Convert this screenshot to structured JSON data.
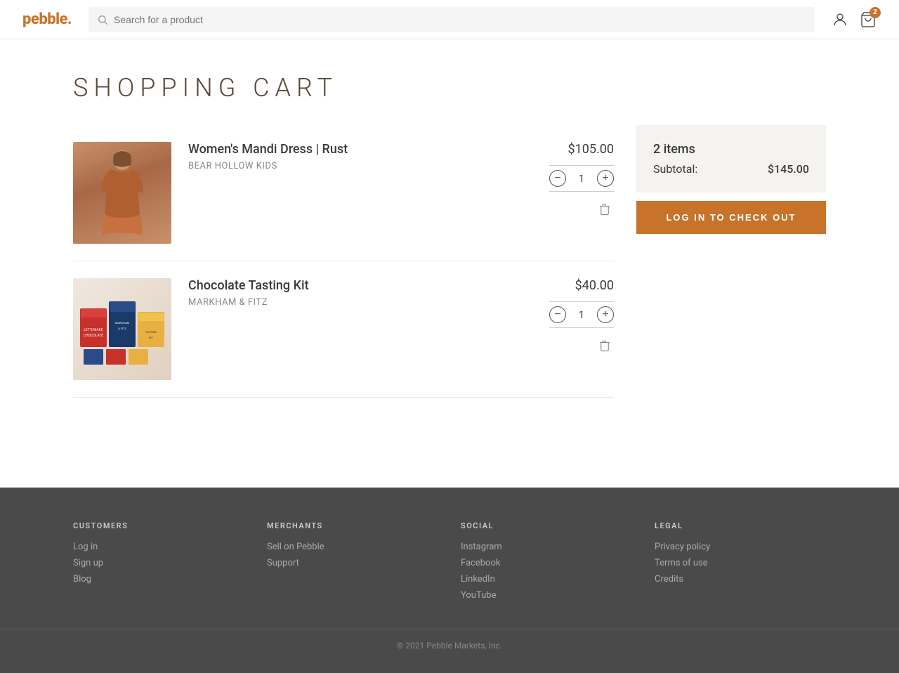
{
  "header": {
    "logo": "pebble.",
    "search_placeholder": "Search for a product",
    "cart_count": "2"
  },
  "page": {
    "title": "SHOPPING CART"
  },
  "cart": {
    "items": [
      {
        "id": "item-1",
        "name": "Women's Mandi Dress | Rust",
        "brand": "Bear Hollow Kids",
        "price": "$105.00",
        "qty": "1",
        "image_type": "dress"
      },
      {
        "id": "item-2",
        "name": "Chocolate Tasting Kit",
        "brand": "MARKHAM & FITZ",
        "price": "$40.00",
        "qty": "1",
        "image_type": "chocolate"
      }
    ],
    "summary": {
      "item_count": "2 items",
      "subtotal_label": "Subtotal:",
      "subtotal_value": "$145.00",
      "checkout_label": "LOG IN TO CHECK OUT"
    }
  },
  "footer": {
    "columns": [
      {
        "heading": "CUSTOMERS",
        "links": [
          "Log in",
          "Sign up",
          "Blog"
        ]
      },
      {
        "heading": "MERCHANTS",
        "links": [
          "Sell on Pebble",
          "Support"
        ]
      },
      {
        "heading": "SOCIAL",
        "links": [
          "Instagram",
          "Facebook",
          "LinkedIn",
          "YouTube"
        ]
      },
      {
        "heading": "LEGAL",
        "links": [
          "Privacy policy",
          "Terms of use",
          "Credits"
        ]
      }
    ],
    "copyright": "© 2021 Pebble Markets, Inc."
  }
}
